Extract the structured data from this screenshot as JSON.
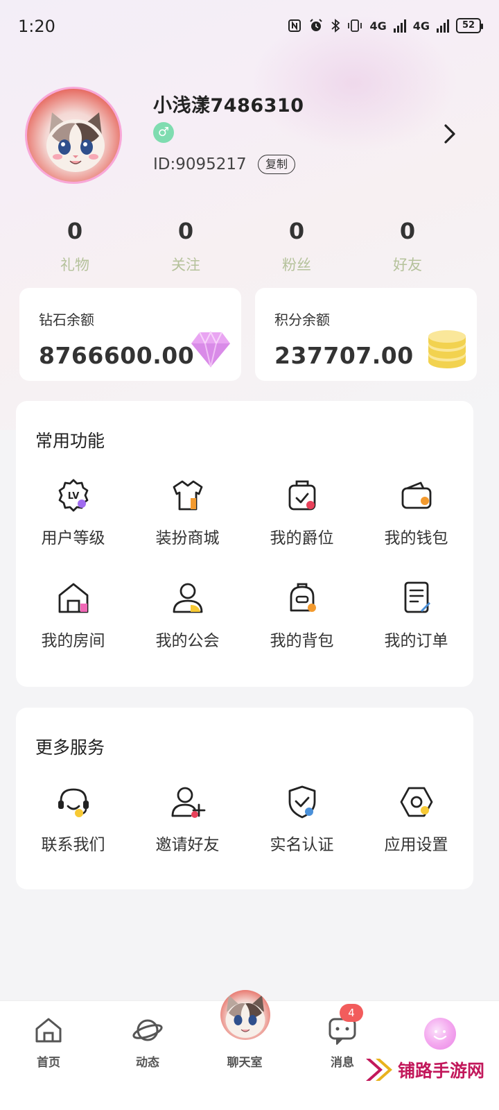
{
  "status_bar": {
    "time": "1:20",
    "net1": "4G",
    "net2": "4G",
    "battery": "52"
  },
  "profile": {
    "username": "小浅漾7486310",
    "gender_symbol": "♂",
    "user_id": "ID:9095217",
    "copy_label": "复制"
  },
  "stats": [
    {
      "value": "0",
      "label": "礼物"
    },
    {
      "value": "0",
      "label": "关注"
    },
    {
      "value": "0",
      "label": "粉丝"
    },
    {
      "value": "0",
      "label": "好友"
    }
  ],
  "balances": {
    "diamond": {
      "title": "钻石余额",
      "value": "8766600.00"
    },
    "points": {
      "title": "积分余额",
      "value": "237707.00"
    }
  },
  "common_features": {
    "title": "常用功能",
    "items": [
      {
        "label": "用户等级",
        "icon": "level-badge-icon"
      },
      {
        "label": "装扮商城",
        "icon": "shirt-icon"
      },
      {
        "label": "我的爵位",
        "icon": "crown-bag-icon"
      },
      {
        "label": "我的钱包",
        "icon": "wallet-icon"
      },
      {
        "label": "我的房间",
        "icon": "house-icon"
      },
      {
        "label": "我的公会",
        "icon": "guild-person-icon"
      },
      {
        "label": "我的背包",
        "icon": "backpack-icon"
      },
      {
        "label": "我的订单",
        "icon": "order-document-icon"
      }
    ]
  },
  "more_services": {
    "title": "更多服务",
    "items": [
      {
        "label": "联系我们",
        "icon": "headset-icon"
      },
      {
        "label": "邀请好友",
        "icon": "add-friend-icon"
      },
      {
        "label": "实名认证",
        "icon": "shield-check-icon"
      },
      {
        "label": "应用设置",
        "icon": "settings-hexagon-icon"
      }
    ]
  },
  "bottom_nav": {
    "items": [
      {
        "label": "首页",
        "icon": "home-icon"
      },
      {
        "label": "动态",
        "icon": "planet-icon"
      },
      {
        "label": "聊天室",
        "icon": "chatroom-avatar-icon"
      },
      {
        "label": "消息",
        "icon": "message-icon",
        "badge": "4"
      },
      {
        "label": "",
        "icon": "profile-orb-icon"
      }
    ]
  },
  "watermark": {
    "text": "铺路手游网"
  },
  "colors": {
    "accent_green": "#7fdcb0",
    "stat_label": "#b5c29b",
    "badge_red": "#f25c5c",
    "icon_yellow": "#f7c934",
    "icon_purple": "#a06cf0",
    "icon_red": "#e8415a",
    "icon_orange": "#f39a2e",
    "icon_pink": "#f067b5",
    "icon_blue": "#4a90d9"
  }
}
